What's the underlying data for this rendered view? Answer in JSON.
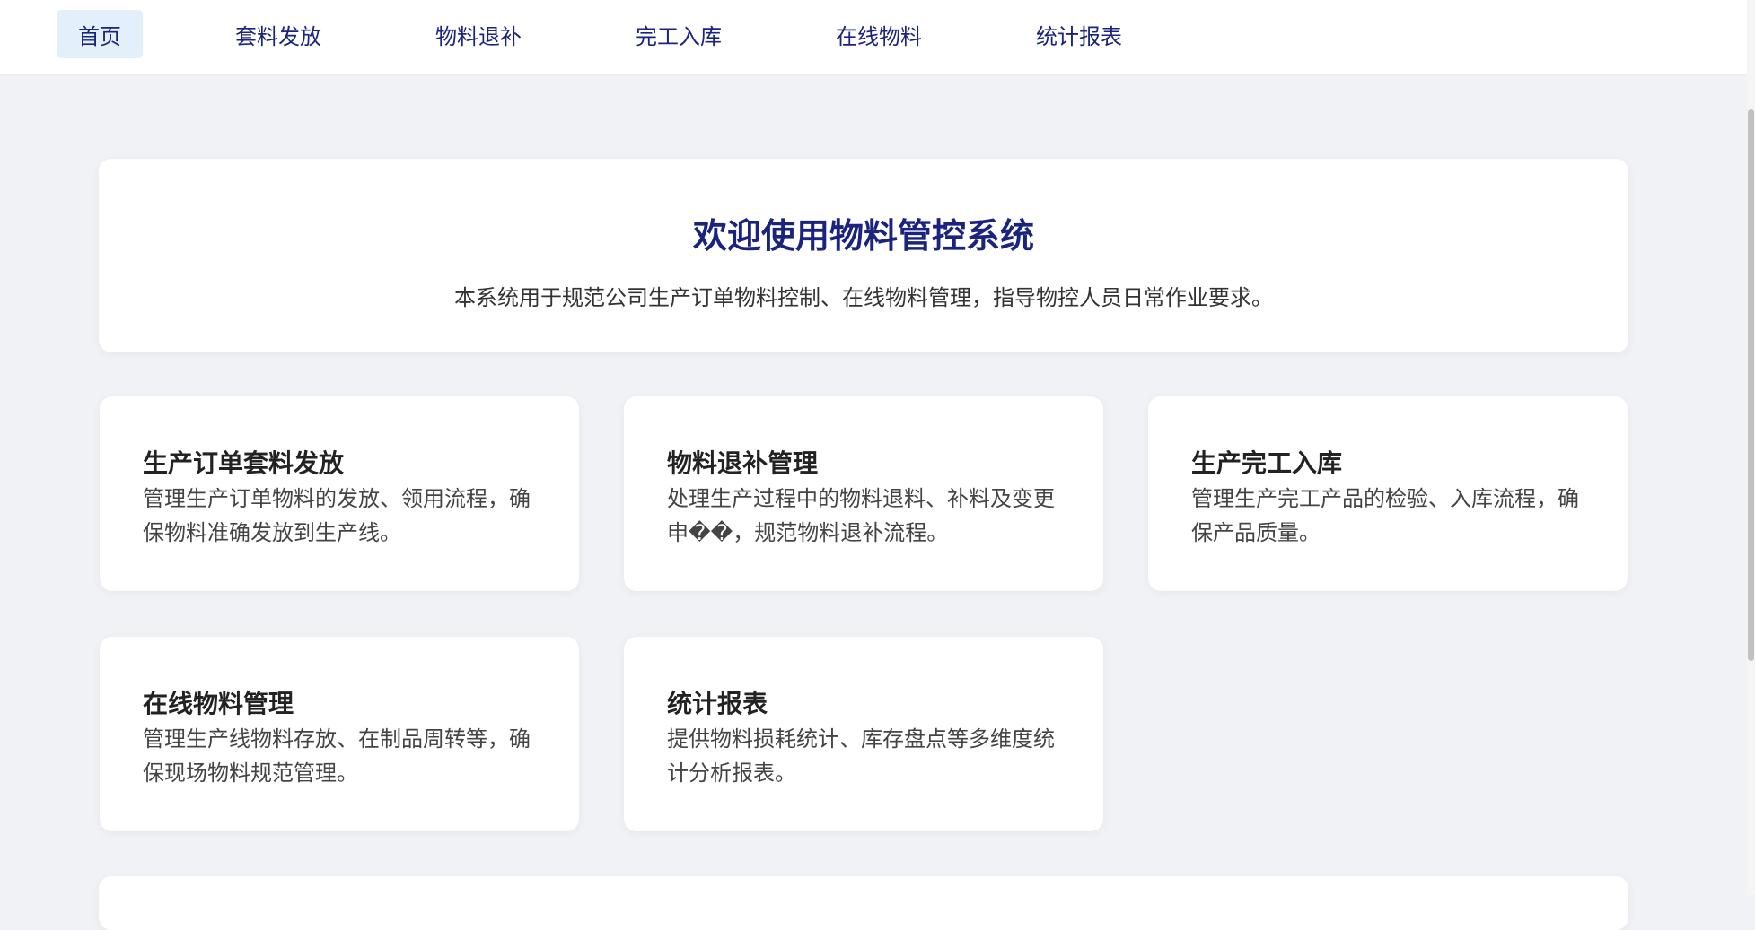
{
  "nav": {
    "items": [
      {
        "label": "首页",
        "active": true
      },
      {
        "label": "套料发放"
      },
      {
        "label": "物料退补"
      },
      {
        "label": "完工入库"
      },
      {
        "label": "在线物料"
      },
      {
        "label": "统计报表"
      }
    ]
  },
  "welcome": {
    "title": "欢迎使用物料管控系统",
    "description": "本系统用于规范公司生产订单物料控制、在线物料管理，指导物控人员日常作业要求。"
  },
  "features": [
    {
      "title": "生产订单套料发放",
      "description": "管理生产订单物料的发放、领用流程，确保物料准确发放到生产线。"
    },
    {
      "title": "物料退补管理",
      "description": "处理生产过程中的物料退料、补料及变更申��，规范物料退补流程。"
    },
    {
      "title": "生产完工入库",
      "description": "管理生产完工产品的检验、入库流程，确保产品质量。"
    },
    {
      "title": "在线物料管理",
      "description": "管理生产线物料存放、在制品周转等，确保现场物料规范管理。"
    },
    {
      "title": "统计报表",
      "description": "提供物料损耗统计、库存盘点等多维度统计分析报表。"
    }
  ],
  "colors": {
    "accent": "#1a237e",
    "nav_active_bg": "#e3f0fc",
    "page_bg": "#f0f2f5"
  }
}
